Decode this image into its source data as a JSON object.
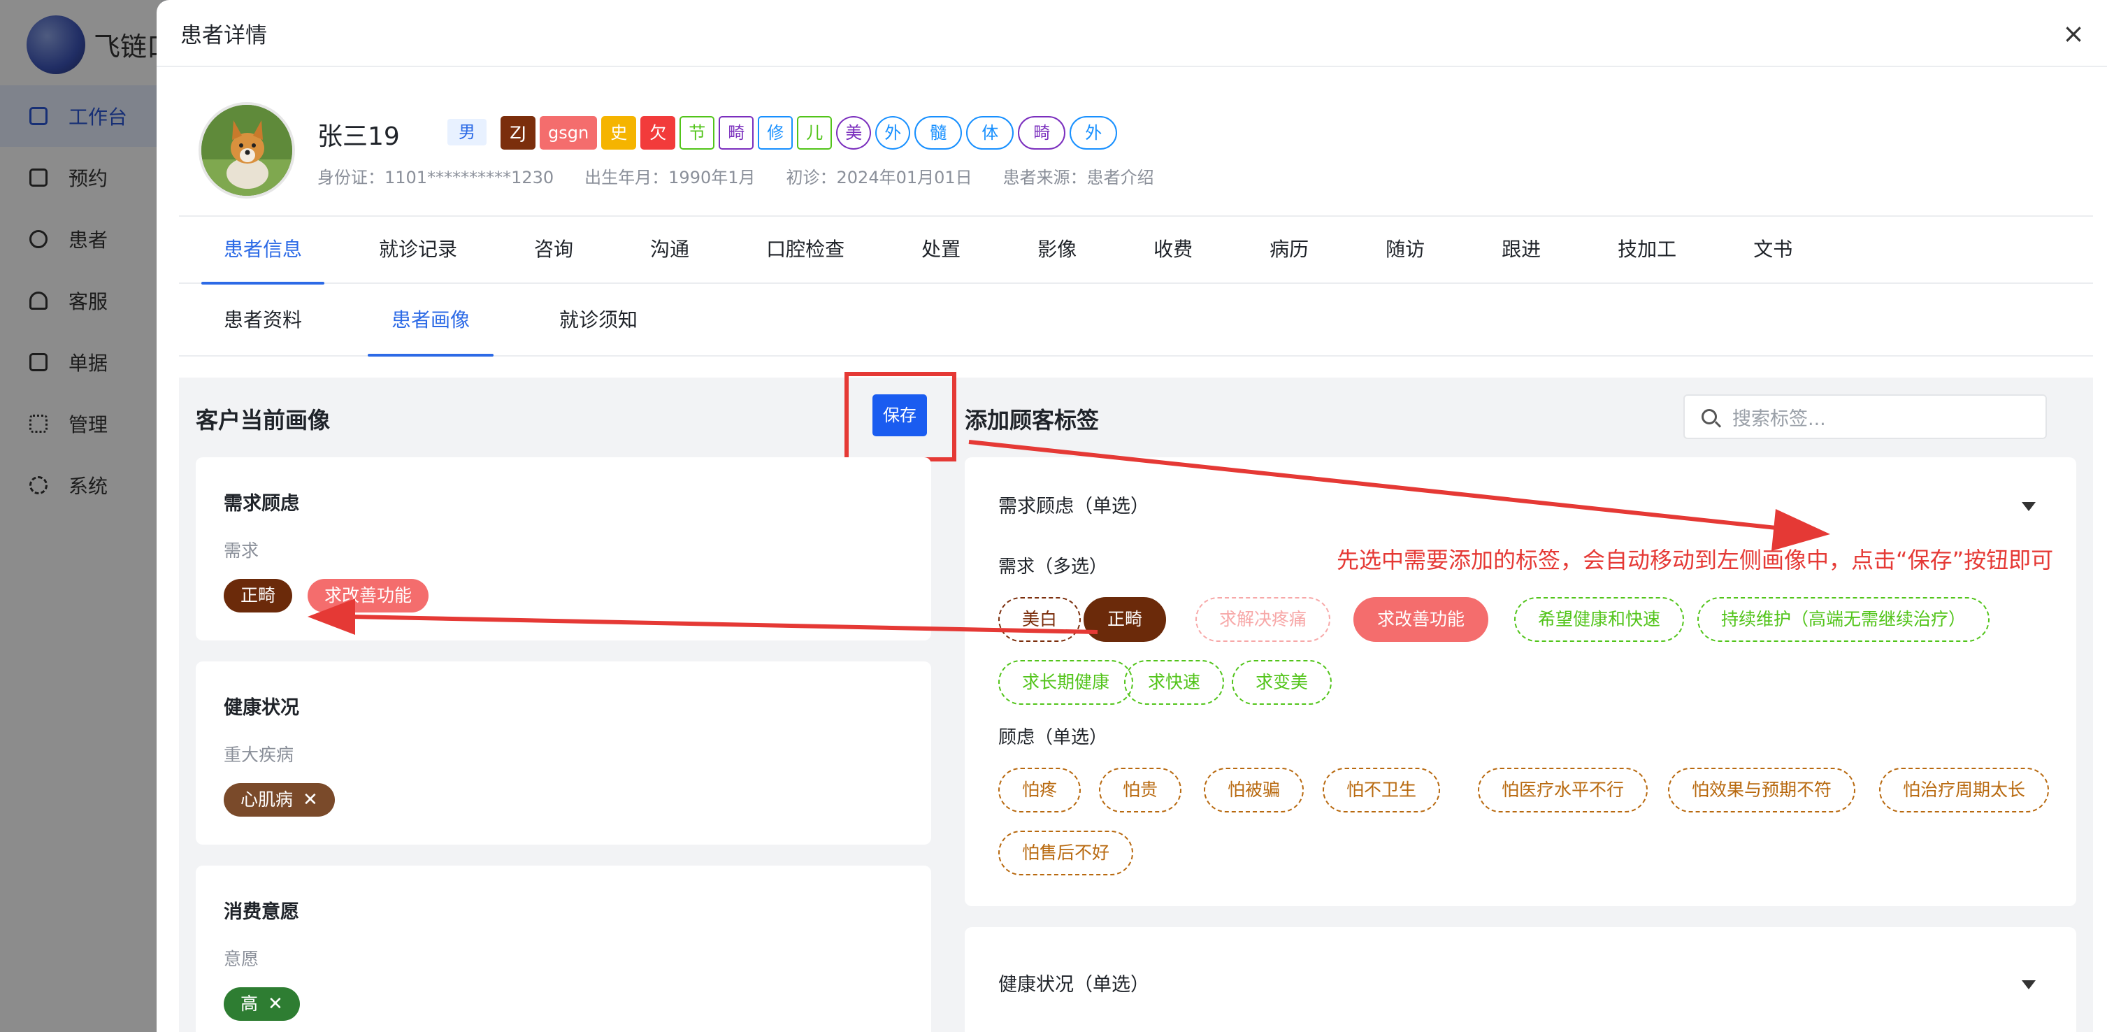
{
  "app": {
    "name": "飞链口",
    "nav": [
      {
        "label": "工作台",
        "icon": "monitor-icon",
        "active": true
      },
      {
        "label": "预约",
        "icon": "calendar-icon"
      },
      {
        "label": "患者",
        "icon": "user-icon"
      },
      {
        "label": "客服",
        "icon": "headset-icon"
      },
      {
        "label": "单据",
        "icon": "document-icon"
      },
      {
        "label": "管理",
        "icon": "grid-icon"
      },
      {
        "label": "系统",
        "icon": "gear-icon"
      }
    ]
  },
  "drawer": {
    "title": "患者详情",
    "close": "×"
  },
  "patient": {
    "name": "张三19",
    "gender": "男",
    "tags": [
      {
        "text": "ZJ",
        "style": "solid",
        "color": "#7b2e0c"
      },
      {
        "text": "gsgn",
        "style": "solid",
        "color": "#f46d6d"
      },
      {
        "text": "史",
        "style": "solid",
        "color": "#f5b400"
      },
      {
        "text": "欠",
        "style": "solid",
        "color": "#f23b3b"
      },
      {
        "text": "节",
        "style": "outline",
        "color": "#52c41a"
      },
      {
        "text": "畸",
        "style": "outline",
        "color": "#7b2fbe"
      },
      {
        "text": "修",
        "style": "outline",
        "color": "#1890ff"
      },
      {
        "text": "儿",
        "style": "outline",
        "color": "#52c41a"
      },
      {
        "text": "美",
        "style": "circle",
        "color": "#7b2fbe"
      },
      {
        "text": "外",
        "style": "circle",
        "color": "#1890ff"
      },
      {
        "text": "髓",
        "style": "pill",
        "color": "#1890ff"
      },
      {
        "text": "体",
        "style": "pill",
        "color": "#1890ff"
      },
      {
        "text": "畸",
        "style": "pill",
        "color": "#7b2fbe"
      },
      {
        "text": "外",
        "style": "pill",
        "color": "#1890ff"
      }
    ],
    "info": [
      "身份证：1101**********1230",
      "出生年月：1990年1月",
      "初诊：2024年01月01日",
      "患者来源：患者介绍"
    ]
  },
  "tabs": [
    "患者信息",
    "就诊记录",
    "咨询",
    "沟通",
    "口腔检查",
    "处置",
    "影像",
    "收费",
    "病历",
    "随访",
    "跟进",
    "技加工",
    "文书"
  ],
  "active_tab": "患者信息",
  "subtabs": [
    "患者资料",
    "患者画像",
    "就诊须知"
  ],
  "active_subtab": "患者画像",
  "portrait": {
    "title": "客户当前画像",
    "save_label": "保存",
    "cards": [
      {
        "title": "需求顾虑",
        "sub": "需求",
        "chips": [
          {
            "text": "正畸",
            "color": "#6b2a0a",
            "closable": false
          },
          {
            "text": "求改善功能",
            "color": "#f46d6d",
            "closable": false
          }
        ]
      },
      {
        "title": "健康状况",
        "sub": "重大疾病",
        "chips": [
          {
            "text": "心肌病",
            "color": "#7a4a2a",
            "closable": true
          }
        ]
      },
      {
        "title": "消费意愿",
        "sub": "意愿",
        "chips": [
          {
            "text": "高",
            "color": "#2e7d32",
            "closable": true
          }
        ]
      }
    ]
  },
  "add_tags": {
    "title": "添加顾客标签",
    "search_placeholder": "搜索标签...",
    "group1": {
      "title": "需求顾虑（单选）",
      "need_label": "需求（多选）",
      "need_tags": [
        {
          "text": "美白",
          "state": "dashed",
          "color": "#7b2e0c"
        },
        {
          "text": "正畸",
          "state": "selected",
          "color": "#6b2a0a"
        },
        {
          "text": "求解决疼痛",
          "state": "dashed",
          "color": "#f7a8a8"
        },
        {
          "text": "求改善功能",
          "state": "selected",
          "color": "#f46d6d"
        },
        {
          "text": "希望健康和快速",
          "state": "dashed",
          "color": "#52c41a"
        },
        {
          "text": "持续维护（高端无需继续治疗）",
          "state": "dashed",
          "color": "#52c41a"
        },
        {
          "text": "求长期健康",
          "state": "dashed",
          "color": "#52c41a"
        },
        {
          "text": "求快速",
          "state": "dashed",
          "color": "#52c41a"
        },
        {
          "text": "求变美",
          "state": "dashed",
          "color": "#52c41a"
        }
      ],
      "worry_label": "顾虑（单选）",
      "worry_tags": [
        {
          "text": "怕疼",
          "color": "#b8690f"
        },
        {
          "text": "怕贵",
          "color": "#b8690f"
        },
        {
          "text": "怕被骗",
          "color": "#b8690f"
        },
        {
          "text": "怕不卫生",
          "color": "#b8690f"
        },
        {
          "text": "怕医疗水平不行",
          "color": "#b8690f"
        },
        {
          "text": "怕效果与预期不符",
          "color": "#b8690f"
        },
        {
          "text": "怕治疗周期太长",
          "color": "#b8690f"
        },
        {
          "text": "怕售后不好",
          "color": "#b8690f"
        }
      ]
    },
    "group2": {
      "title": "健康状况（单选）"
    }
  },
  "annotation": "先选中需要添加的标签，会自动移动到左侧画像中，点击“保存”按钮即可",
  "colors": {
    "primary": "#2c6ae6",
    "save": "#1a5cf0",
    "annotation": "#e53935"
  }
}
